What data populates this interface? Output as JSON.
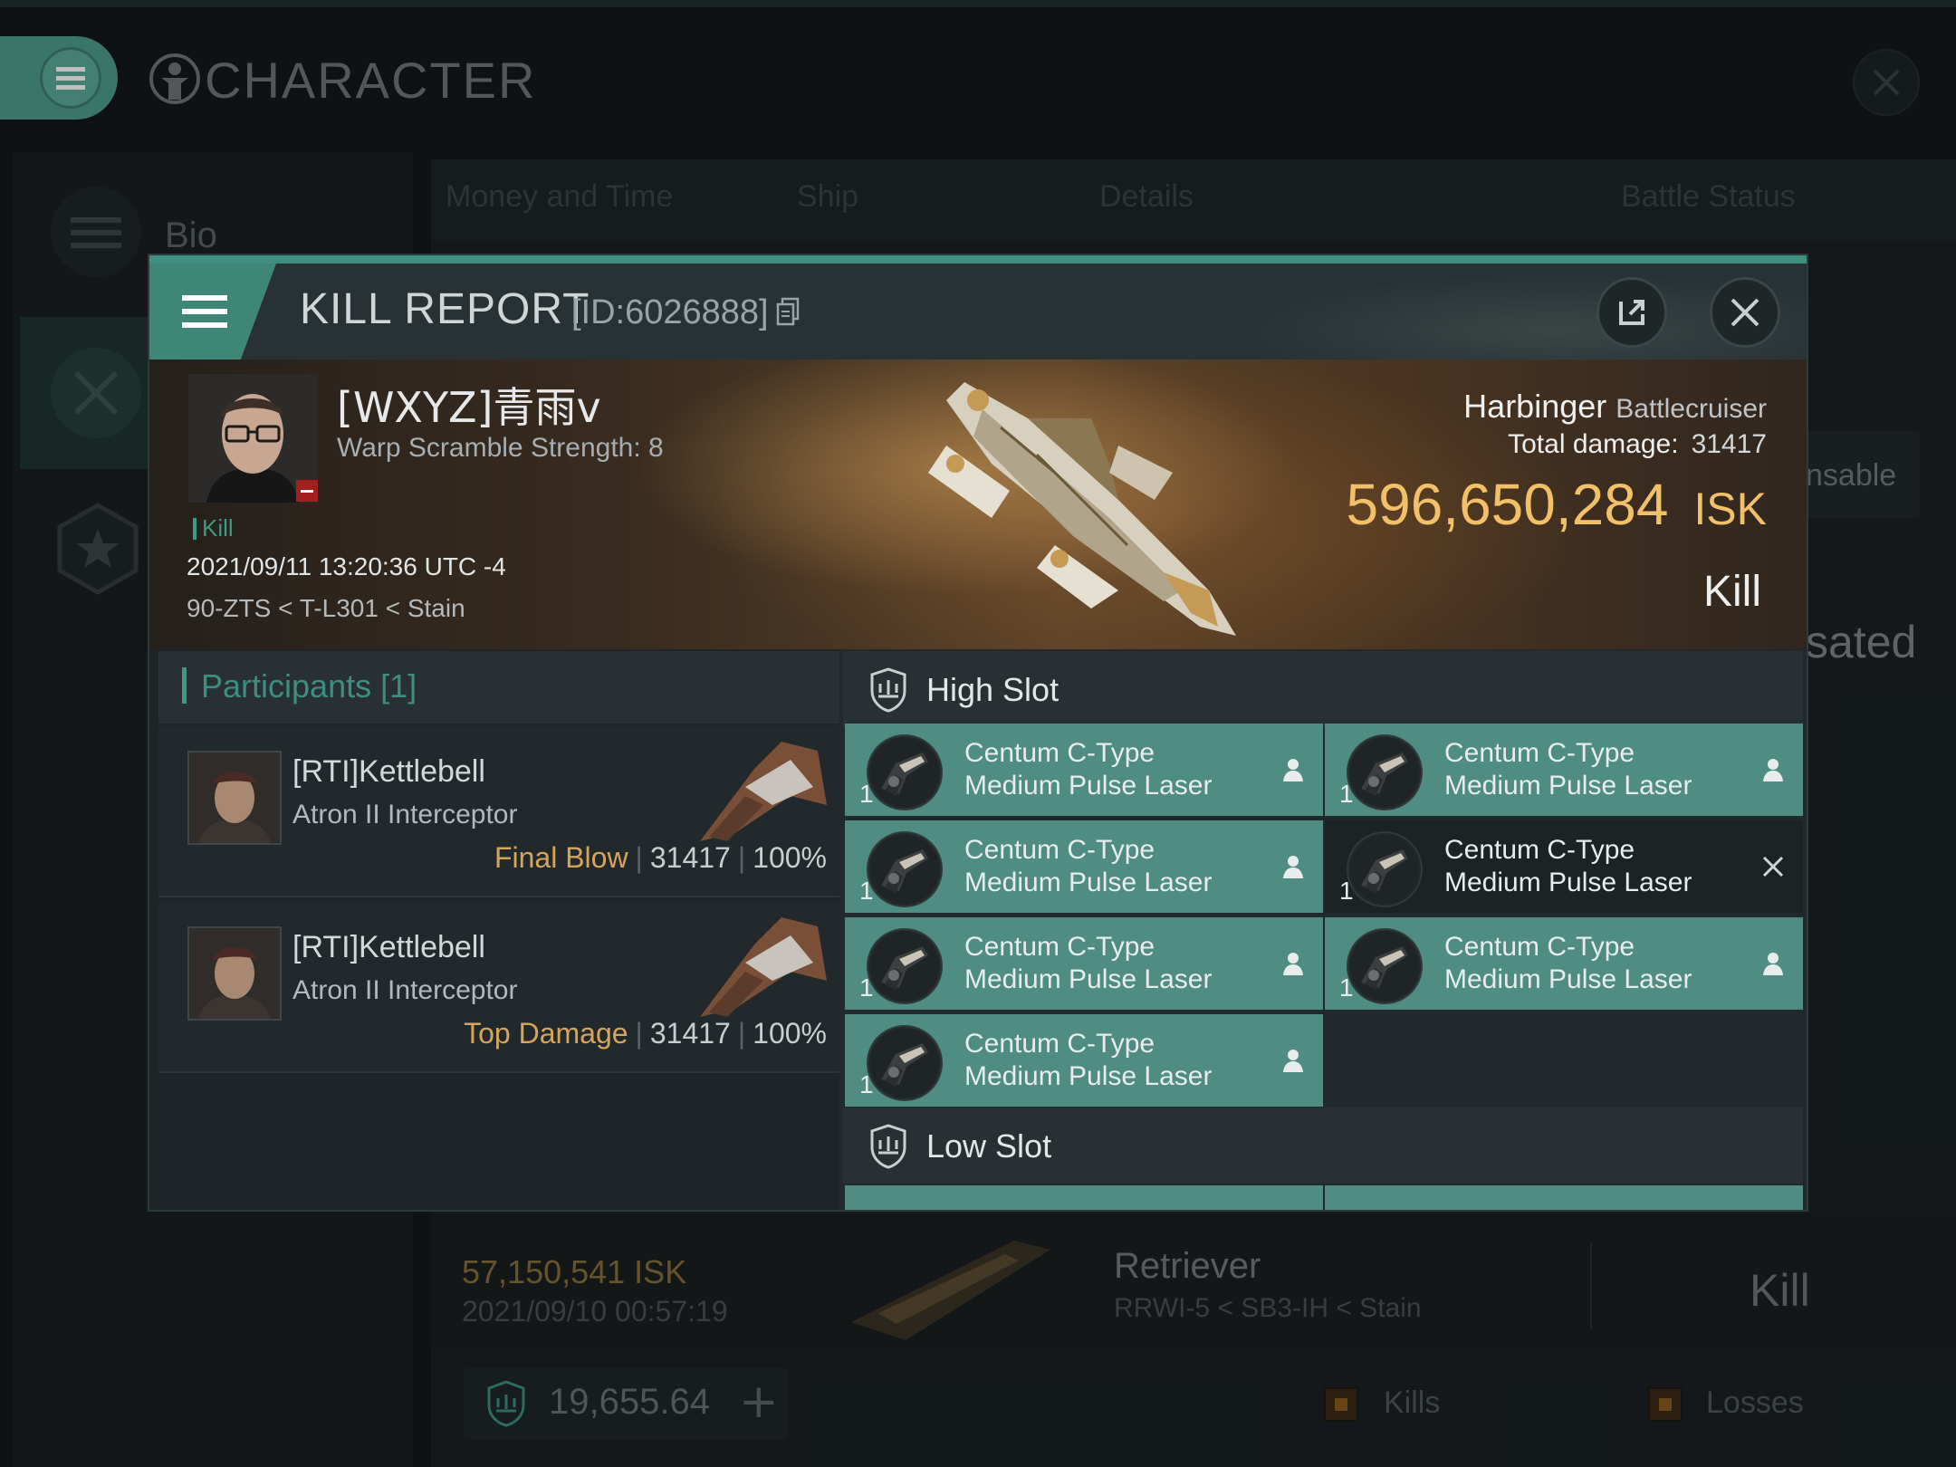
{
  "colors": {
    "accent": "#3f8f80",
    "module_fitted": "#4f8c82",
    "isk_gold": "#f1c068",
    "final_blow": "#d6a55a",
    "destroyed_badge": "#a31e1e"
  },
  "background": {
    "title": "CHARACTER",
    "sidebar": {
      "bio_label": "Bio",
      "icons": [
        "menu-icon",
        "crossed-swords-icon",
        "star-badge-icon"
      ]
    },
    "tabs": [
      "Money and Time",
      "Ship",
      "Details",
      "Battle Status"
    ],
    "peek": {
      "unusable": "nsable",
      "compensated": "sated"
    },
    "kill_row": {
      "isk": "57,150,541  ISK",
      "date": "2021/09/10  00:57:19",
      "ship": "Retriever",
      "location": "RRWI-5 < SB3-IH < Stain",
      "type": "Kill"
    },
    "wallet": {
      "value": "19,655.64",
      "plus": "+"
    },
    "legend": {
      "kills": "Kills",
      "losses": "Losses"
    }
  },
  "modal": {
    "title": "KILL REPORT",
    "id": "[ID:6026888]",
    "victim": {
      "pilot": "[WXYZ]青雨v",
      "warp_scramble": "Warp Scramble Strength: 8",
      "tag": "Kill",
      "date": "2021/09/11 13:20:36 UTC -4",
      "location": "90-ZTS < T-L301 < Stain",
      "ship": "Harbinger",
      "ship_class": "Battlecruiser",
      "total_damage_label": "Total damage:",
      "total_damage": "31417",
      "isk": "596,650,284",
      "isk_unit": "ISK",
      "type": "Kill"
    },
    "participants": {
      "label": "Participants [1]",
      "rows": [
        {
          "name": "[RTI]Kettlebell",
          "ship": "Atron II Interceptor",
          "label": "Final Blow",
          "damage": "31417",
          "percent": "100%"
        },
        {
          "name": "[RTI]Kettlebell",
          "ship": "Atron II Interceptor",
          "label": "Top Damage",
          "damage": "31417",
          "percent": "100%"
        }
      ]
    },
    "high_slot": {
      "label": "High Slot",
      "modules": [
        {
          "line1": "Centum C-Type",
          "line2": "Medium Pulse Laser",
          "qty": "1",
          "status": "dropped"
        },
        {
          "line1": "Centum C-Type",
          "line2": "Medium Pulse Laser",
          "qty": "1",
          "status": "dropped"
        },
        {
          "line1": "Centum C-Type",
          "line2": "Medium Pulse Laser",
          "qty": "1",
          "status": "dropped"
        },
        {
          "line1": "Centum C-Type",
          "line2": "Medium Pulse Laser",
          "qty": "1",
          "status": "destroyed"
        },
        {
          "line1": "Centum C-Type",
          "line2": "Medium Pulse Laser",
          "qty": "1",
          "status": "dropped"
        },
        {
          "line1": "Centum C-Type",
          "line2": "Medium Pulse Laser",
          "qty": "1",
          "status": "dropped"
        },
        {
          "line1": "Centum C-Type",
          "line2": "Medium Pulse Laser",
          "qty": "1",
          "status": "dropped"
        }
      ]
    },
    "low_slot": {
      "label": "Low Slot"
    }
  }
}
